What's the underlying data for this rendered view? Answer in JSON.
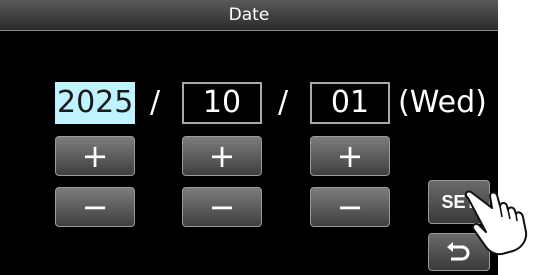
{
  "title": "Date",
  "date": {
    "year": "2025",
    "month": "10",
    "day": "01",
    "separator": "/",
    "weekday": "(Wed)"
  },
  "buttons": {
    "plus": "+",
    "minus": "−",
    "set": "SET",
    "back_icon": "return-arrow-icon"
  },
  "pointer_icon": "tapping-hand-icon",
  "colors": {
    "background": "#000000",
    "selected_field": "#bff3ff",
    "button_gray": "#5a5a5a"
  }
}
